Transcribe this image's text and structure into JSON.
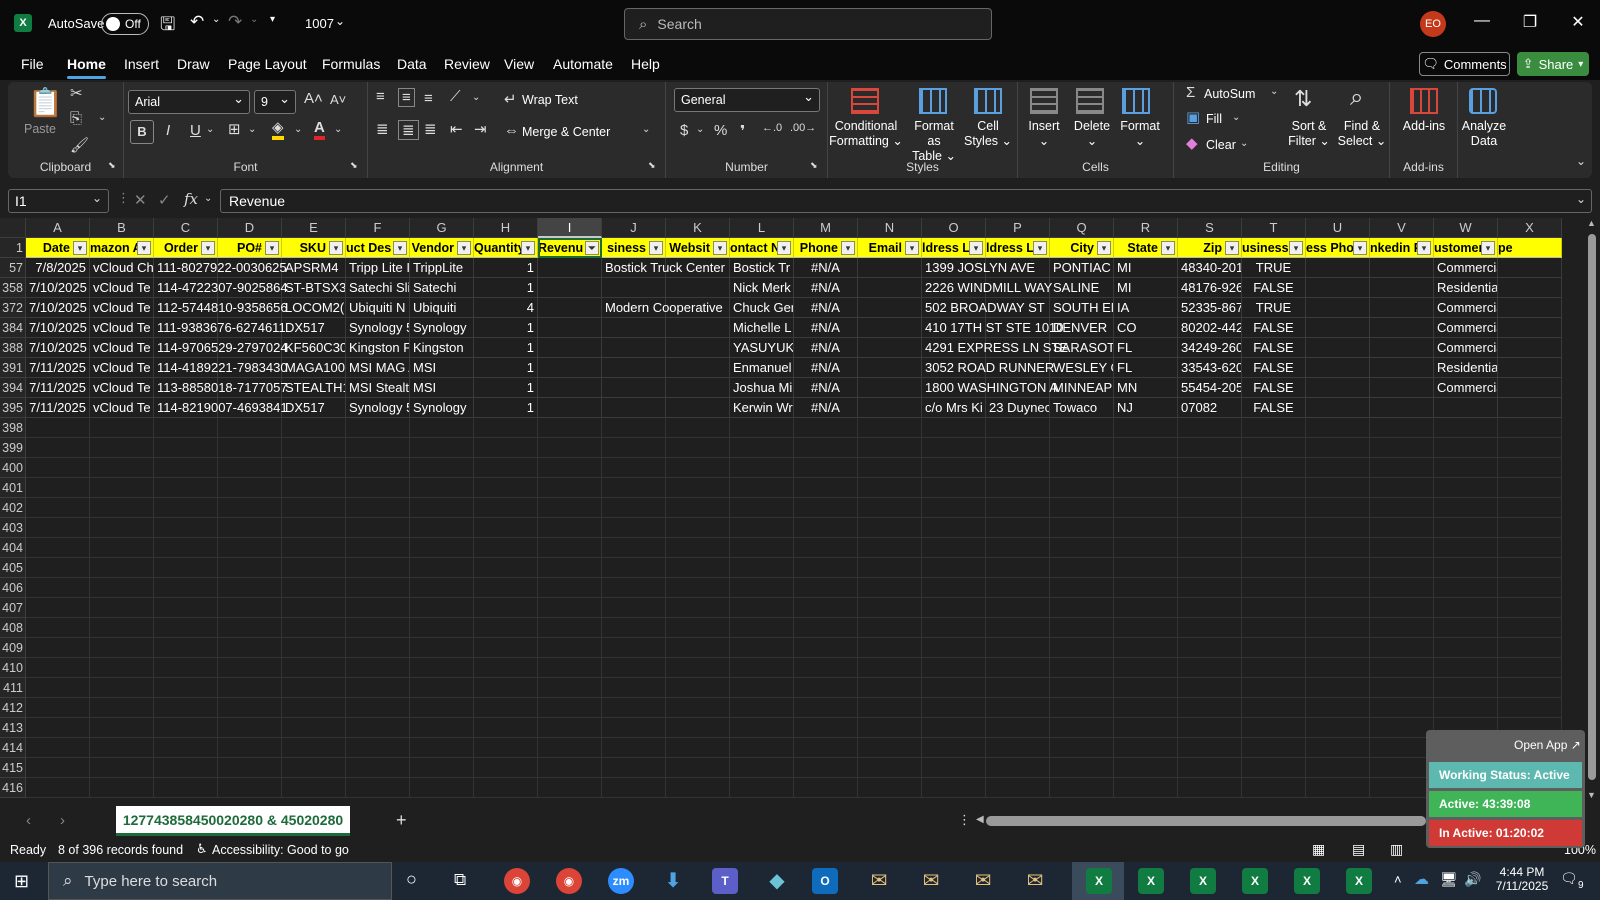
{
  "app": {
    "autosave_label": "AutoSave",
    "autosave_state": "Off",
    "filename": "1007",
    "search_placeholder": "Search",
    "avatar_initials": "EO"
  },
  "menu": [
    "File",
    "Home",
    "Insert",
    "Draw",
    "Page Layout",
    "Formulas",
    "Data",
    "Review",
    "View",
    "Automate",
    "Help"
  ],
  "actions": {
    "comments": "Comments",
    "share": "Share"
  },
  "ribbon": {
    "clipboard": {
      "label": "Clipboard",
      "paste": "Paste"
    },
    "font": {
      "label": "Font",
      "name": "Arial",
      "size": "9"
    },
    "alignment": {
      "label": "Alignment",
      "wrap": "Wrap Text",
      "merge": "Merge & Center"
    },
    "number": {
      "label": "Number",
      "format": "General"
    },
    "styles": {
      "label": "Styles",
      "cond_l1": "Conditional",
      "cond_l2": "Formatting",
      "table_l1": "Format as",
      "table_l2": "Table",
      "cell_l1": "Cell",
      "cell_l2": "Styles"
    },
    "cells": {
      "label": "Cells",
      "insert": "Insert",
      "delete": "Delete",
      "format": "Format"
    },
    "editing": {
      "label": "Editing",
      "autosum": "AutoSum",
      "fill": "Fill",
      "clear": "Clear",
      "sort_l1": "Sort &",
      "sort_l2": "Filter",
      "find_l1": "Find &",
      "find_l2": "Select"
    },
    "addins": {
      "label": "Add-ins",
      "addins": "Add-ins",
      "analyze_l1": "Analyze",
      "analyze_l2": "Data"
    }
  },
  "formula_bar": {
    "name_box": "I1",
    "content": "Revenue"
  },
  "columns": [
    "A",
    "B",
    "C",
    "D",
    "E",
    "F",
    "G",
    "H",
    "I",
    "J",
    "K",
    "L",
    "M",
    "N",
    "O",
    "P",
    "Q",
    "R",
    "S",
    "T",
    "U",
    "V",
    "W",
    "X"
  ],
  "header_row": [
    "Date",
    "mazon Ac",
    "Order",
    "PO#",
    "SKU",
    "uct Des",
    "Vendor",
    "Quantity",
    "Revenu",
    "siness",
    "Websit",
    "ontact N",
    "Phone",
    "Email",
    "ldress L",
    "ldress L",
    "City",
    "State",
    "Zip",
    "usiness",
    "ess Phor",
    "nkedin P",
    "ustomer",
    "pe"
  ],
  "row_numbers": [
    "1",
    "57",
    "358",
    "372",
    "384",
    "388",
    "391",
    "394",
    "395",
    "398",
    "399",
    "400",
    "401",
    "402",
    "403",
    "404",
    "405",
    "406",
    "407",
    "408",
    "409",
    "410",
    "411",
    "412",
    "413",
    "414",
    "415",
    "416"
  ],
  "rows": [
    {
      "A": "7/8/2025",
      "B": "vCloud Ch",
      "C": "111-8027922-0030625",
      "D": "",
      "E": "APSRM4",
      "F": "Tripp Lite I",
      "G": "TrippLite",
      "H": "1",
      "J": "Bostick Truck Center",
      "L": "Bostick Tr",
      "M": "#N/A",
      "O": "1399 JOSLYN AVE",
      "P": "",
      "Q": "PONTIAC",
      "R": "MI",
      "S": "48340-201",
      "T": "TRUE",
      "W": "Commercial"
    },
    {
      "A": "7/10/2025",
      "B": "vCloud Te",
      "C": "114-4722307-9025864",
      "D": "",
      "E": "ST-BTSX3N",
      "F": "Satechi Sli",
      "G": "Satechi",
      "H": "1",
      "J": "",
      "L": "Nick Merk",
      "M": "#N/A",
      "O": "2226 WINDMILL WAY",
      "P": "",
      "Q": "SALINE",
      "R": "MI",
      "S": "48176-926",
      "T": "FALSE",
      "W": "Residential"
    },
    {
      "A": "7/10/2025",
      "B": "vCloud Te",
      "C": "112-5744810-9358656",
      "D": "",
      "E": "LOCOM2(U",
      "F": "Ubiquiti N",
      "G": "Ubiquiti",
      "H": "4",
      "J": "Modern Cooperative",
      "L": "Chuck Ger",
      "M": "#N/A",
      "O": "502 BROADWAY ST",
      "P": "",
      "Q": "SOUTH EN",
      "R": "IA",
      "S": "52335-867",
      "T": "TRUE",
      "W": "Commercial"
    },
    {
      "A": "7/10/2025",
      "B": "vCloud Te",
      "C": "111-9383676-6274611",
      "D": "",
      "E": "DX517",
      "F": "Synology 5",
      "G": "Synology",
      "H": "1",
      "J": "",
      "L": "Michelle L",
      "M": "#N/A",
      "O": "410 17TH ST STE 1010",
      "P": "",
      "Q": "DENVER",
      "R": "CO",
      "S": "80202-442",
      "T": "FALSE",
      "W": "Commercial"
    },
    {
      "A": "7/10/2025",
      "B": "vCloud Te",
      "C": "114-9706529-2797024",
      "D": "",
      "E": "KF560C30I",
      "F": "Kingston F",
      "G": "Kingston",
      "H": "1",
      "J": "",
      "L": "YASUYUKI",
      "M": "#N/A",
      "O": "4291 EXPRESS LN STE",
      "P": "",
      "Q": "SARASOTA",
      "R": "FL",
      "S": "34249-260",
      "T": "FALSE",
      "W": "Commercial"
    },
    {
      "A": "7/11/2025",
      "B": "vCloud Te",
      "C": "114-4189221-7983430",
      "D": "",
      "E": "MAGA100(",
      "F": "MSI MAG A",
      "G": "MSI",
      "H": "1",
      "J": "",
      "L": "Enmanuel",
      "M": "#N/A",
      "O": "3052 ROAD RUNNER",
      "P": "",
      "Q": "WESLEY CH",
      "R": "FL",
      "S": "33543-620",
      "T": "FALSE",
      "W": "Residential"
    },
    {
      "A": "7/11/2025",
      "B": "vCloud Te",
      "C": "113-8858018-7177057",
      "D": "",
      "E": "STEALTH1(",
      "F": "MSI Stealt",
      "G": "MSI",
      "H": "1",
      "J": "",
      "L": "Joshua Mi",
      "M": "#N/A",
      "O": "1800 WASHINGTON A",
      "P": "",
      "Q": "MINNEAP(",
      "R": "MN",
      "S": "55454-205",
      "T": "FALSE",
      "W": "Commercial"
    },
    {
      "A": "7/11/2025",
      "B": "vCloud Te",
      "C": "114-8219007-4693841",
      "D": "",
      "E": "DX517",
      "F": "Synology 5",
      "G": "Synology",
      "H": "1",
      "J": "",
      "L": "Kerwin Wr",
      "M": "#N/A",
      "O": "c/o Mrs Ki",
      "P": "23 Duynec",
      "Q": "Towaco",
      "R": "NJ",
      "S": "07082",
      "T": "FALSE",
      "W": ""
    }
  ],
  "sheet_tab": "127743858450020280 & 45020280",
  "status": {
    "ready": "Ready",
    "records": "8 of 396 records found",
    "accessibility": "Accessibility: Good to go",
    "zoom": "100%"
  },
  "overlay": {
    "open_app": "Open App ↗",
    "working": "Working Status: Active",
    "active": "Active: 43:39:08",
    "inactive": "In Active: 01:20:02"
  },
  "taskbar": {
    "search_placeholder": "Type here to search",
    "time": "4:44 PM",
    "date": "7/11/2025",
    "notif": "9"
  },
  "colors": {
    "header_fill": "#ffff00",
    "excel_green": "#107c41",
    "share_green": "#3a8c3f",
    "accent_blue": "#4fa3e0",
    "active_green": "#3fb557",
    "inactive_red": "#d03a36",
    "working_teal": "#5db8b0"
  }
}
